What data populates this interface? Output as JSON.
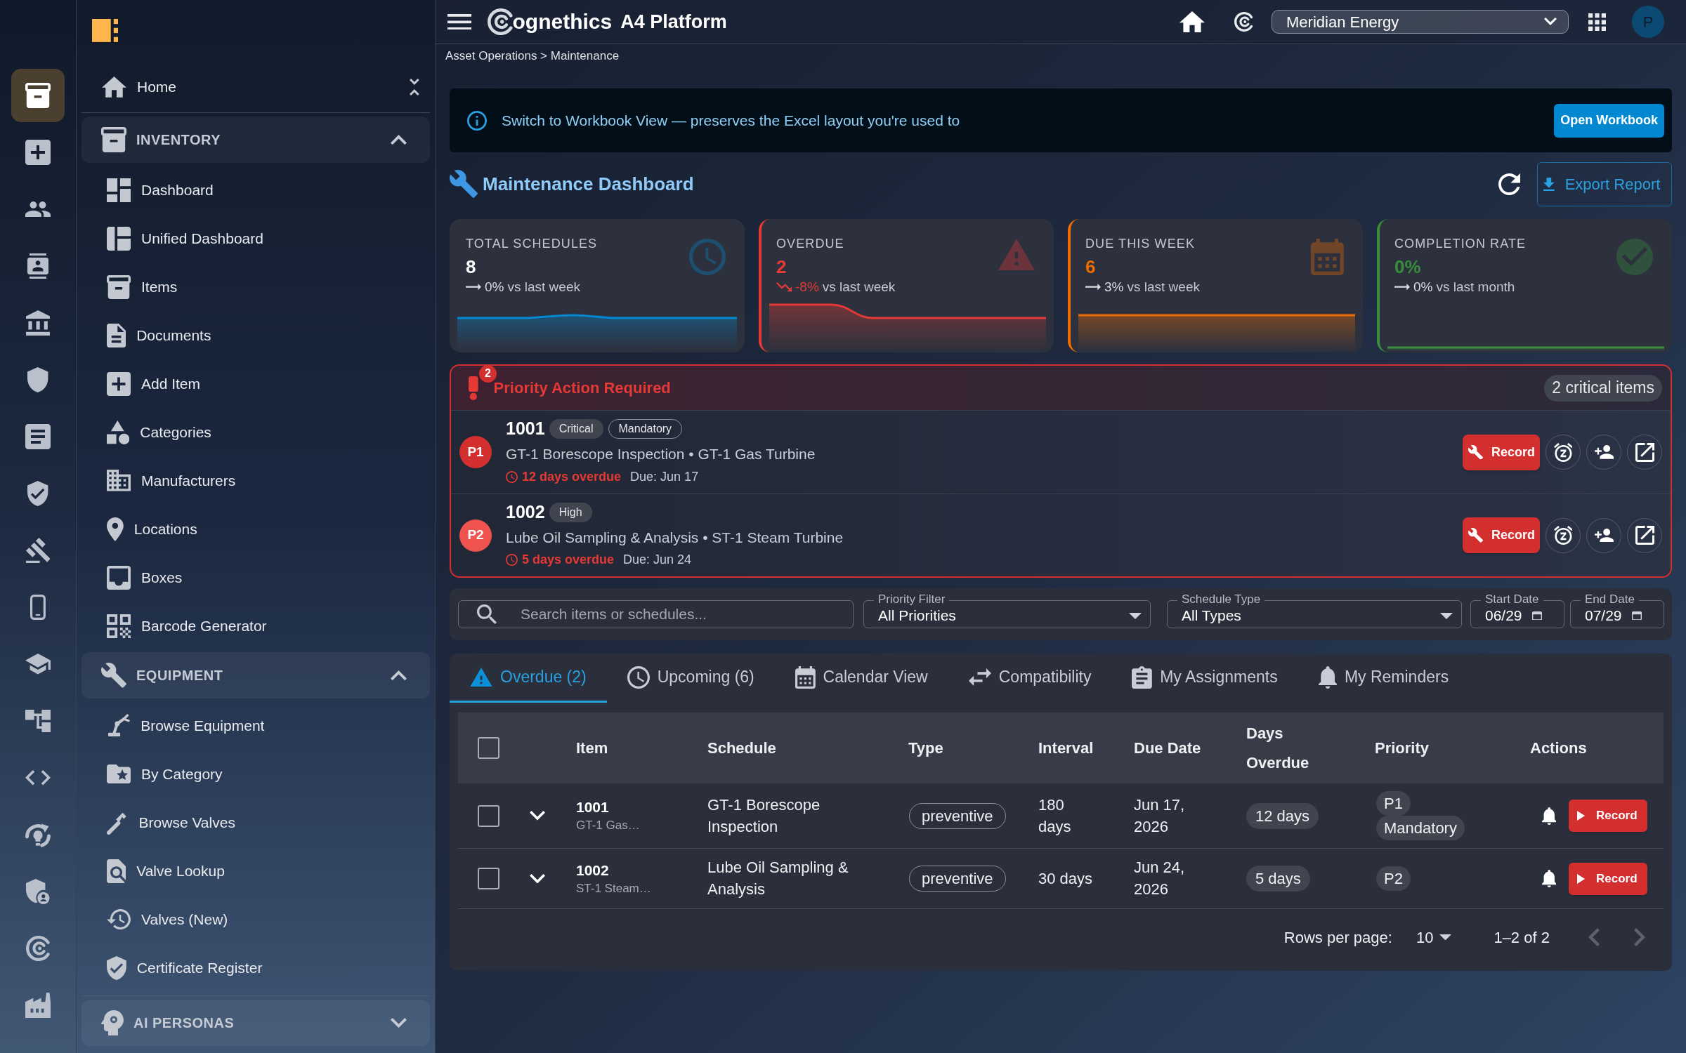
{
  "rail": [
    {
      "selected": true
    },
    {
      "selected": false
    },
    {
      "selected": false
    },
    {
      "selected": false
    },
    {
      "selected": false
    },
    {
      "selected": false
    },
    {
      "selected": false
    },
    {
      "selected": false
    },
    {
      "selected": false
    },
    {
      "selected": false
    },
    {
      "selected": false
    },
    {
      "selected": false
    },
    {
      "selected": false
    },
    {
      "selected": false
    },
    {
      "selected": false
    },
    {
      "selected": false
    },
    {
      "selected": false
    }
  ],
  "sidebar": {
    "home": "Home",
    "sections": [
      {
        "title": "INVENTORY",
        "expanded": true,
        "items": [
          "Dashboard",
          "Unified Dashboard",
          "Items",
          "Documents",
          "Add Item",
          "Categories",
          "Manufacturers",
          "Locations",
          "Boxes",
          "Barcode Generator"
        ]
      },
      {
        "title": "EQUIPMENT",
        "expanded": true,
        "items": [
          "Browse Equipment",
          "By Category",
          "Browse Valves",
          "Valve Lookup",
          "Valves (New)",
          "Certificate Register"
        ]
      },
      {
        "title": "AI PERSONAS",
        "expanded": false
      }
    ]
  },
  "topbar": {
    "brand": "ognethics",
    "product": "A4 Platform",
    "organization": "Meridian Energy",
    "avatar": "P"
  },
  "breadcrumb": "Asset Operations > Maintenance",
  "banner": {
    "message": "Switch to Workbook View — preserves the Excel layout you're used to",
    "button": "Open Workbook"
  },
  "header": {
    "title": "Maintenance Dashboard",
    "export_button": "Export Report"
  },
  "kpis": [
    {
      "label": "TOTAL SCHEDULES",
      "value": "8",
      "color": "#0288d1",
      "accented": false,
      "trend": {
        "kind": "flat",
        "delta": "0%",
        "comparison": "vs last week"
      }
    },
    {
      "label": "OVERDUE",
      "value": "2",
      "color": "#e53935",
      "accented": true,
      "trend": {
        "kind": "down",
        "delta": "-8%",
        "comparison": "vs last week"
      }
    },
    {
      "label": "DUE THIS WEEK",
      "value": "6",
      "color": "#ef6c00",
      "accented": true,
      "trend": {
        "kind": "flat",
        "delta": "3%",
        "comparison": "vs last week"
      }
    },
    {
      "label": "COMPLETION RATE",
      "value": "0%",
      "color": "#388e3c",
      "accented": true,
      "trend": {
        "kind": "flat",
        "delta": "0%",
        "comparison": "vs last month"
      }
    }
  ],
  "priority": {
    "title": "Priority Action Required",
    "badge": "2",
    "count": "2 critical items",
    "items": [
      {
        "priority": "P1",
        "color": "#d32f2f",
        "id": "1001",
        "tags": [
          {
            "label": "Critical",
            "kind": "filled"
          },
          {
            "label": "Mandatory",
            "kind": "outlined"
          }
        ],
        "description": "GT-1 Borescope Inspection • GT-1 Gas Turbine",
        "overdue": "12 days overdue",
        "due": "Due: Jun 17",
        "button": "Record"
      },
      {
        "priority": "P2",
        "color": "#ef5350",
        "id": "1002",
        "tags": [
          {
            "label": "High",
            "kind": "filled"
          }
        ],
        "description": "Lube Oil Sampling & Analysis • ST-1 Steam Turbine",
        "overdue": "5 days overdue",
        "due": "Due: Jun 24",
        "button": "Record"
      }
    ]
  },
  "filters": {
    "search": {
      "placeholder": "Search items or schedules..."
    },
    "selects": [
      {
        "label": "Priority Filter",
        "value": "All Priorities"
      },
      {
        "label": "Schedule Type",
        "value": "All Types"
      }
    ],
    "dates": [
      {
        "label": "Start Date",
        "value": "06/29"
      },
      {
        "label": "End Date",
        "value": "07/29"
      }
    ]
  },
  "tabs": [
    {
      "label": "Overdue (2)",
      "selected": true
    },
    {
      "label": "Upcoming (6)",
      "selected": false
    },
    {
      "label": "Calendar View",
      "selected": false
    },
    {
      "label": "Compatibility",
      "selected": false
    },
    {
      "label": "My Assignments",
      "selected": false
    },
    {
      "label": "My Reminders",
      "selected": false
    }
  ],
  "table": {
    "all_checked": false,
    "columns": [
      "Item",
      "Schedule",
      "Type",
      "Interval",
      "Due Date",
      "Days Overdue",
      "Priority",
      "Actions"
    ],
    "rows": [
      {
        "checked": false,
        "expanded": false,
        "item": "1001",
        "asset": "GT-1 Gas…",
        "schedule": "GT-1 Borescope Inspection",
        "type": "preventive",
        "interval": "180 days",
        "due_date": "Jun 17, 2026",
        "days_overdue": "12 days",
        "priority": [
          "P1",
          "Mandatory"
        ],
        "action": "Record"
      },
      {
        "checked": false,
        "expanded": false,
        "item": "1002",
        "asset": "ST-1 Steam…",
        "schedule": "Lube Oil Sampling & Analysis",
        "type": "preventive",
        "interval": "30 days",
        "due_date": "Jun 24, 2026",
        "days_overdue": "5 days",
        "priority": [
          "P2"
        ],
        "action": "Record"
      }
    ]
  },
  "pagination": {
    "label": "Rows per page:",
    "rows_per_page": "10",
    "range": "1–2 of 2",
    "prev_disabled": true,
    "next_disabled": true
  }
}
